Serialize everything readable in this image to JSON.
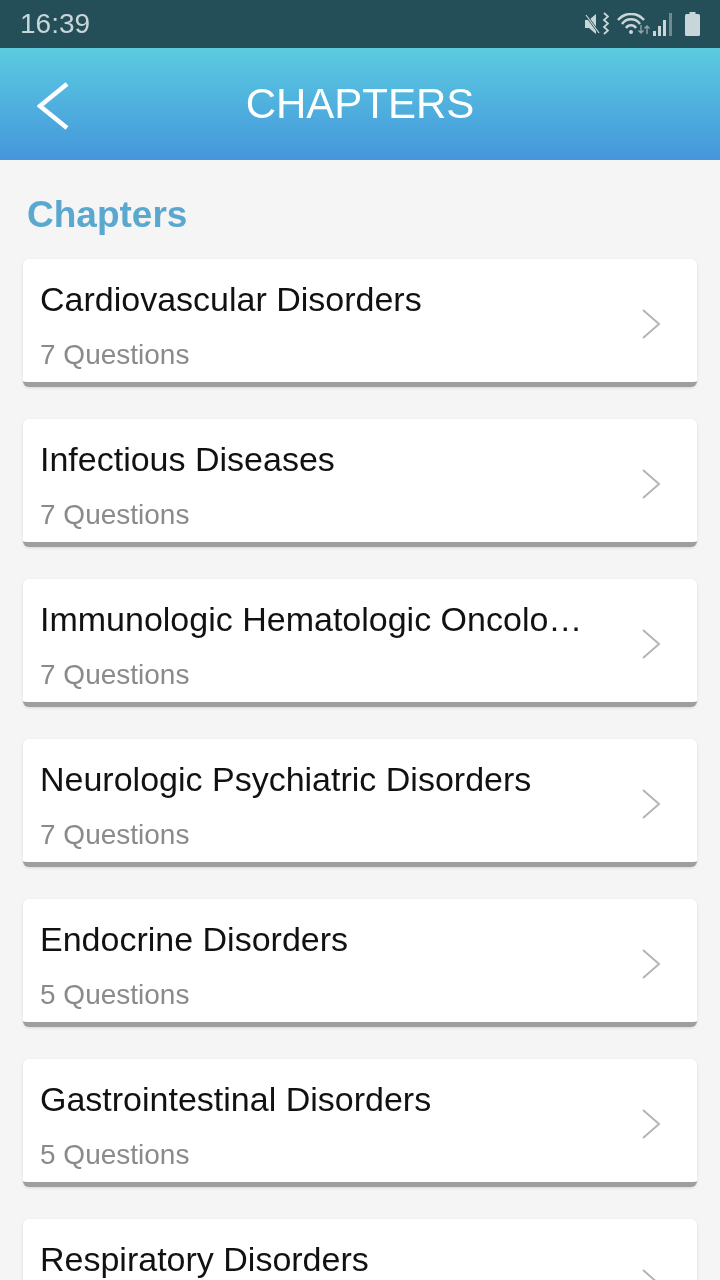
{
  "status_bar": {
    "time": "16:39"
  },
  "header": {
    "title": "CHAPTERS"
  },
  "section_title": "Chapters",
  "chapters": [
    {
      "title": "Cardiovascular Disorders",
      "subtitle": "7 Questions"
    },
    {
      "title": "Infectious Diseases",
      "subtitle": "7 Questions"
    },
    {
      "title": "Immunologic Hematologic Oncolo…",
      "subtitle": "7 Questions"
    },
    {
      "title": "Neurologic Psychiatric Disorders",
      "subtitle": "7 Questions"
    },
    {
      "title": "Endocrine Disorders",
      "subtitle": "5 Questions"
    },
    {
      "title": "Gastrointestinal Disorders",
      "subtitle": "5 Questions"
    },
    {
      "title": "Respiratory Disorders"
    }
  ]
}
